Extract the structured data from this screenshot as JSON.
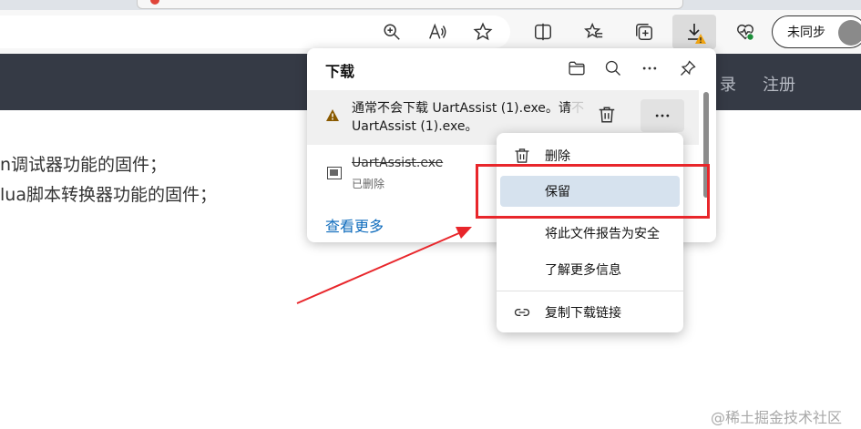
{
  "browser": {
    "sync_label": "未同步",
    "icons": [
      "zoom-icon",
      "read-aloud-icon",
      "favorite-icon",
      "split-screen-icon",
      "favorites-icon",
      "collections-icon",
      "download-icon",
      "browser-essentials-icon"
    ]
  },
  "site": {
    "nav_links": [
      "录",
      "注册"
    ],
    "lines": [
      "n调试器功能的固件；",
      "lua脚本转换器功能的固件；"
    ]
  },
  "downloads": {
    "title": "下载",
    "items": [
      {
        "line1": "通常不会下载 UartAssist (1).exe。请",
        "line1_tail": "不",
        "line2": "UartAssist (1).exe。",
        "status": "warning"
      },
      {
        "name": "UartAssist.exe",
        "status": "已删除"
      }
    ],
    "see_more": "查看更多"
  },
  "context_menu": {
    "items": [
      "删除",
      "保留",
      "将此文件报告为安全",
      "了解更多信息",
      "复制下载链接"
    ],
    "active_index": 1
  },
  "colors": {
    "highlight": "#e8262b",
    "menu_active": "#d6e2ee",
    "nav_bg": "#353a45",
    "link": "#0f6cbd"
  },
  "watermark": "@稀土掘金技术社区"
}
